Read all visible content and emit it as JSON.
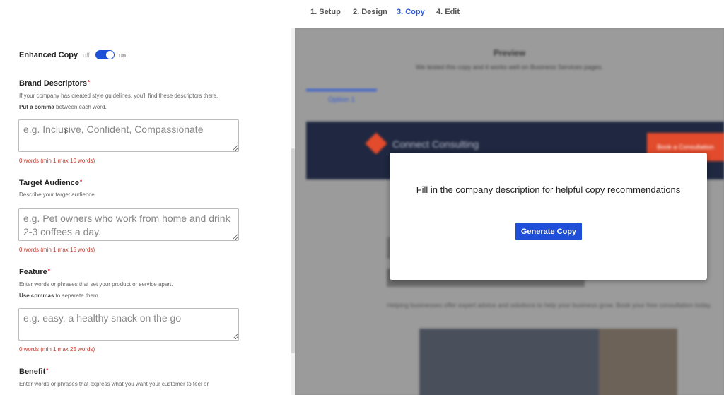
{
  "steps": [
    {
      "label": "1. Setup"
    },
    {
      "label": "2. Design"
    },
    {
      "label": "3. Copy"
    },
    {
      "label": "4. Edit"
    }
  ],
  "form": {
    "enhanced_copy": {
      "label": "Enhanced Copy",
      "off": "off",
      "on": "on",
      "enabled": true
    },
    "brand": {
      "label": "Brand Descriptors",
      "req": "*",
      "help_line1": "If your company has created style guidelines, you'll find these descriptors there.",
      "help_bold": "Put a comma",
      "help_rest": " between each word.",
      "placeholder": "e.g. Inclusive, Confident, Compassionate",
      "count": "0 words (min 1 max 10 words)"
    },
    "audience": {
      "label": "Target Audience",
      "req": "*",
      "help_line1": "Describe your target audience.",
      "placeholder": "e.g. Pet owners who work from home and drink 2-3 coffees a day.",
      "count": "0 words (min 1 max 15 words)"
    },
    "feature": {
      "label": "Feature",
      "req": "*",
      "help_line1": "Enter words or phrases that set your product or service apart.",
      "help_bold": "Use commas",
      "help_rest": " to separate them.",
      "placeholder": "e.g. easy, a healthy snack on the go",
      "count": "0 words (min 1 max 25 words)"
    },
    "benefit": {
      "label": "Benefit",
      "req": "*",
      "help_line1": "Enter words or phrases that express what you want your customer to feel or"
    }
  },
  "preview": {
    "title": "Preview",
    "subtitle": "We tested this copy and it works well on Business Services pages.",
    "tab": "Option 1",
    "brand_name": "Connect Consulting",
    "cta": "Book a Consultation",
    "body": "Helping businesses offer expert advice and solutions to help your business grow. Book your free consultation today."
  },
  "modal": {
    "message": "Fill in the company description for helpful copy recommendations",
    "button": "Generate Copy"
  },
  "colors": {
    "accent": "#1f4fd8",
    "error": "#c0392b",
    "overlay": "#9b9b9b",
    "brand_orange": "#e24b2c",
    "nav_dark": "#1f2840"
  }
}
